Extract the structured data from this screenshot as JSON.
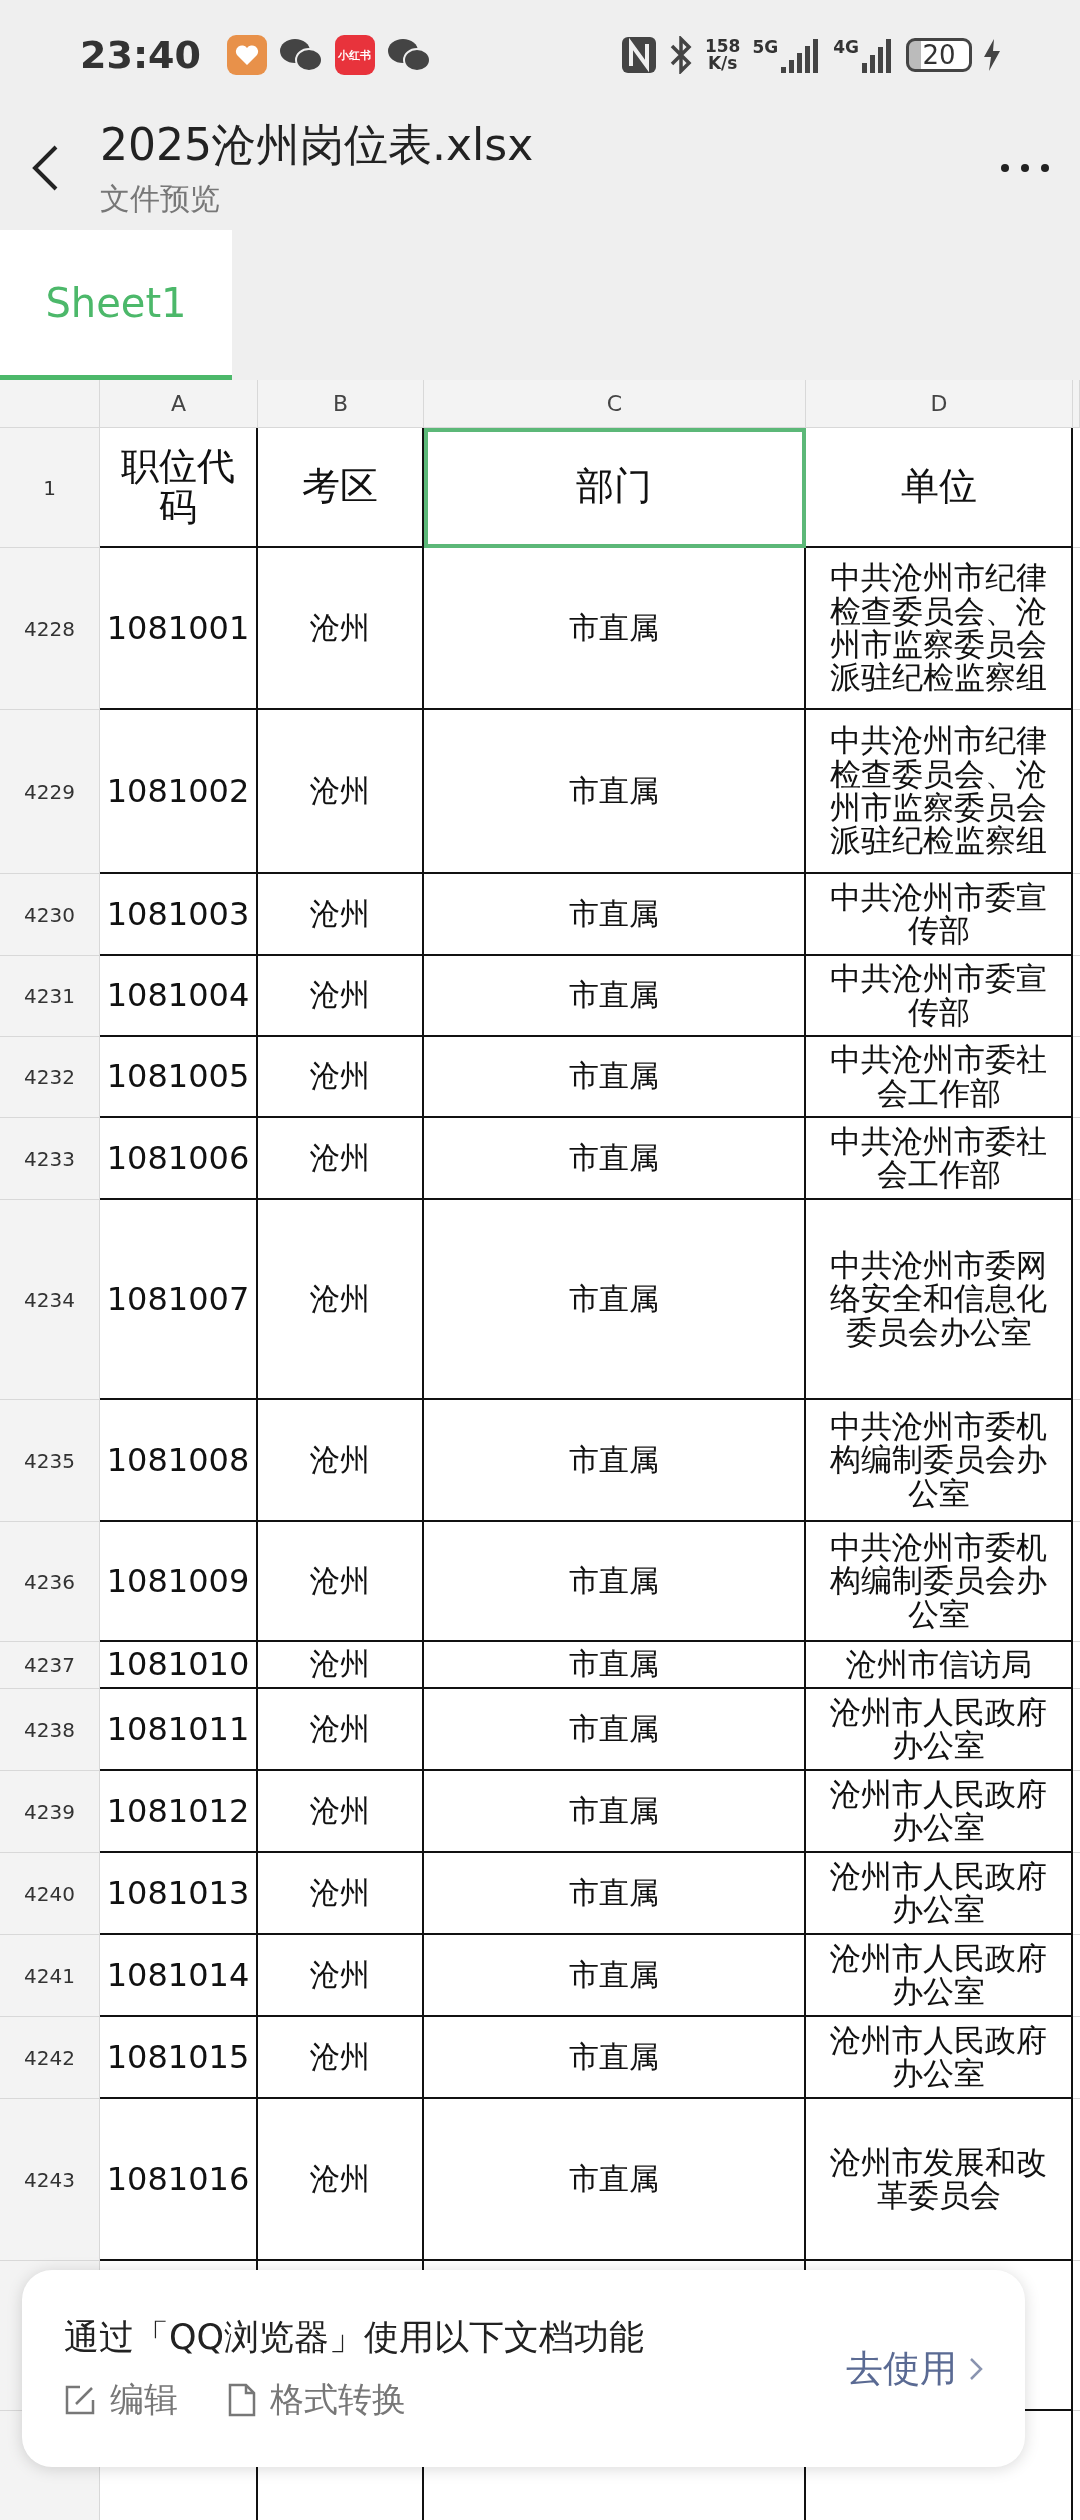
{
  "status_bar": {
    "time": "23:40",
    "app_badge": "小红书",
    "speed_value": "158",
    "speed_unit": "K/s",
    "network_5g": "5G",
    "network_4g": "4G",
    "battery": "20"
  },
  "header": {
    "title": "2025沧州岗位表.xlsx",
    "subtitle": "文件预览"
  },
  "sheet_tabs": [
    {
      "label": "Sheet1",
      "selected": true
    }
  ],
  "columns": [
    "A",
    "B",
    "C",
    "D"
  ],
  "header_row": {
    "number": "1",
    "cells": [
      {
        "text": "职位代码",
        "selected": false
      },
      {
        "text": "考区",
        "selected": false
      },
      {
        "text": "部门",
        "selected": true
      },
      {
        "text": "单位",
        "selected": false
      }
    ]
  },
  "rows": [
    {
      "number": "4228",
      "a": "1081001",
      "b": "沧州",
      "c": "市直属",
      "d": "中共沧州市纪律检查委员会、沧州市监察委员会派驻纪检监察组"
    },
    {
      "number": "4229",
      "a": "1081002",
      "b": "沧州",
      "c": "市直属",
      "d": "中共沧州市纪律检查委员会、沧州市监察委员会派驻纪检监察组"
    },
    {
      "number": "4230",
      "a": "1081003",
      "b": "沧州",
      "c": "市直属",
      "d": "中共沧州市委宣传部"
    },
    {
      "number": "4231",
      "a": "1081004",
      "b": "沧州",
      "c": "市直属",
      "d": "中共沧州市委宣传部"
    },
    {
      "number": "4232",
      "a": "1081005",
      "b": "沧州",
      "c": "市直属",
      "d": "中共沧州市委社会工作部"
    },
    {
      "number": "4233",
      "a": "1081006",
      "b": "沧州",
      "c": "市直属",
      "d": "中共沧州市委社会工作部"
    },
    {
      "number": "4234",
      "a": "1081007",
      "b": "沧州",
      "c": "市直属",
      "d": "中共沧州市委网络安全和信息化委员会办公室"
    },
    {
      "number": "4235",
      "a": "1081008",
      "b": "沧州",
      "c": "市直属",
      "d": "中共沧州市委机构编制委员会办公室"
    },
    {
      "number": "4236",
      "a": "1081009",
      "b": "沧州",
      "c": "市直属",
      "d": "中共沧州市委机构编制委员会办公室"
    },
    {
      "number": "4237",
      "a": "1081010",
      "b": "沧州",
      "c": "市直属",
      "d": "沧州市信访局"
    },
    {
      "number": "4238",
      "a": "1081011",
      "b": "沧州",
      "c": "市直属",
      "d": "沧州市人民政府办公室"
    },
    {
      "number": "4239",
      "a": "1081012",
      "b": "沧州",
      "c": "市直属",
      "d": "沧州市人民政府办公室"
    },
    {
      "number": "4240",
      "a": "1081013",
      "b": "沧州",
      "c": "市直属",
      "d": "沧州市人民政府办公室"
    },
    {
      "number": "4241",
      "a": "1081014",
      "b": "沧州",
      "c": "市直属",
      "d": "沧州市人民政府办公室"
    },
    {
      "number": "4242",
      "a": "1081015",
      "b": "沧州",
      "c": "市直属",
      "d": "沧州市人民政府办公室"
    },
    {
      "number": "4243",
      "a": "1081016",
      "b": "沧州",
      "c": "市直属",
      "d": "沧州市发展和改革委员会"
    }
  ],
  "promo": {
    "message": "通过「QQ浏览器」使用以下文档功能",
    "features": [
      "编辑",
      "格式转换"
    ],
    "action": "去使用"
  }
}
